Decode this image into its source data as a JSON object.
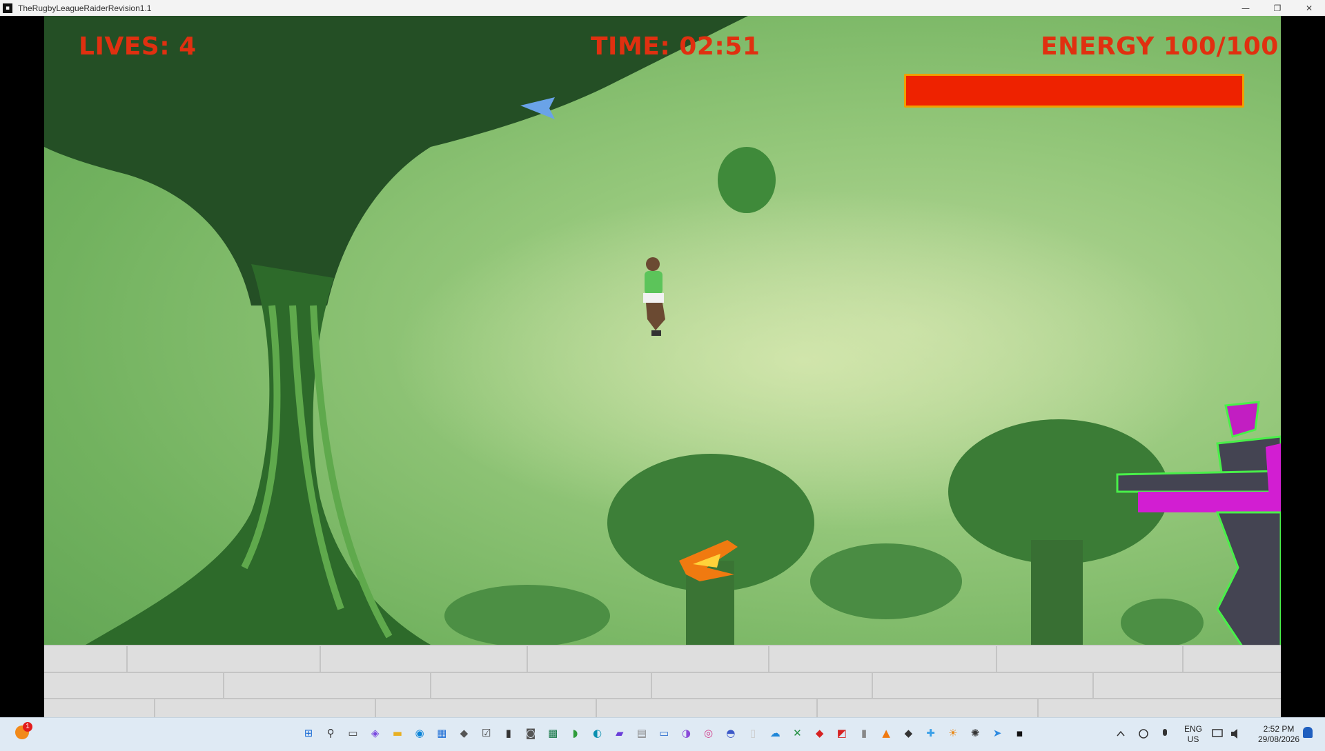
{
  "window": {
    "title": "TheRugbyLeagueRaiderRevision1.1",
    "controls": [
      "—",
      "❐",
      "✕"
    ]
  },
  "hud": {
    "lives_label": "LIVES: 4",
    "time_label": "TIME: 02:51",
    "energy_label": "ENERGY 100/100",
    "energy_fraction": 1.0,
    "energy_color": "#ee2200",
    "energy_border_color": "#f0a000",
    "hud_color": "#e03010"
  },
  "taskbar": {
    "notification_badge": "1",
    "icons": [
      "windows-start-icon",
      "search-icon",
      "task-view-icon",
      "copilot-icon",
      "file-explorer-icon",
      "edge-icon",
      "store-icon",
      "app-icon",
      "checklist-icon",
      "chart-icon",
      "camera-icon",
      "grid-app-icon",
      "app-icon",
      "app-icon",
      "app-icon",
      "app-icon",
      "app-icon",
      "app-icon",
      "app-icon",
      "app-icon",
      "document-icon",
      "onedrive-icon",
      "xbox-icon",
      "vivaldi-icon",
      "app-icon",
      "app-icon",
      "vlc-icon",
      "app-icon",
      "app-icon",
      "app-icon",
      "chatgpt-icon",
      "app-icon",
      "game-icon"
    ],
    "tray": {
      "language_top": "ENG",
      "language_bottom": "US",
      "time": "2:52 PM",
      "date": "29/08/2026"
    }
  }
}
